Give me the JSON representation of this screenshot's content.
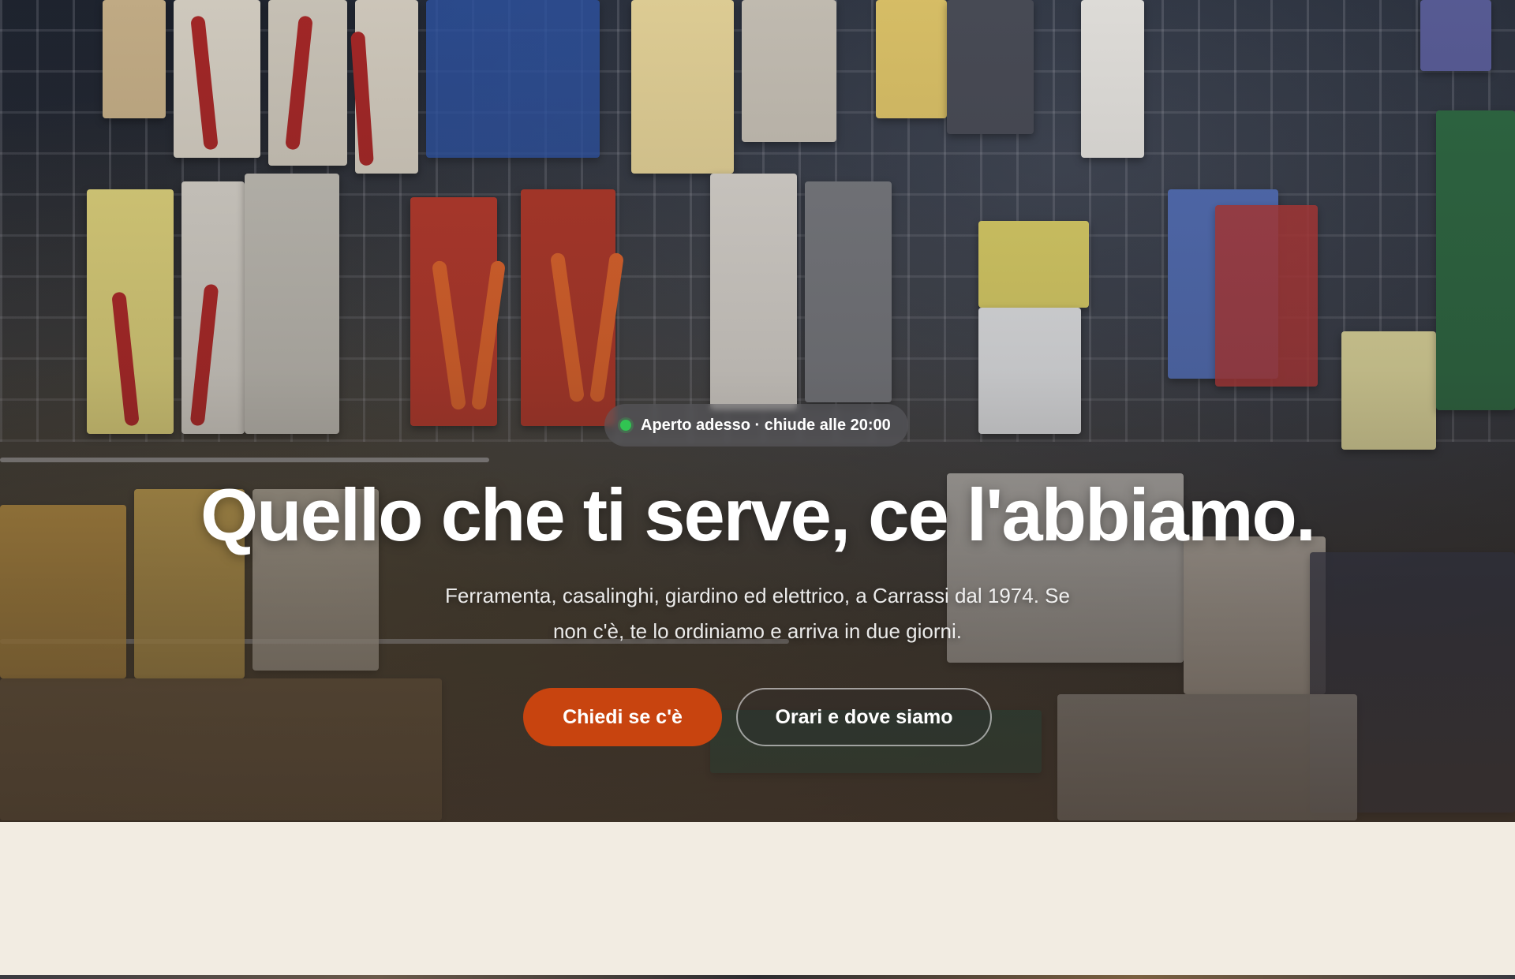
{
  "hero": {
    "status": "Aperto adesso · chiude alle 20:00",
    "headline": "Quello che ti serve, ce l'abbiamo.",
    "subtitle": "Ferramenta, casalinghi, giardino ed elettrico, a Carrassi dal 1974. Se non c'è, te lo ordiniamo e arriva in due giorni.",
    "cta_primary": "Chiedi se c'è",
    "cta_secondary": "Orari e dove siamo",
    "image_alt": "Hardware store wall with pliers and tools on display"
  },
  "colors": {
    "accent": "#c8440f",
    "status_dot": "#31c452",
    "page_background": "#f2ece2"
  }
}
